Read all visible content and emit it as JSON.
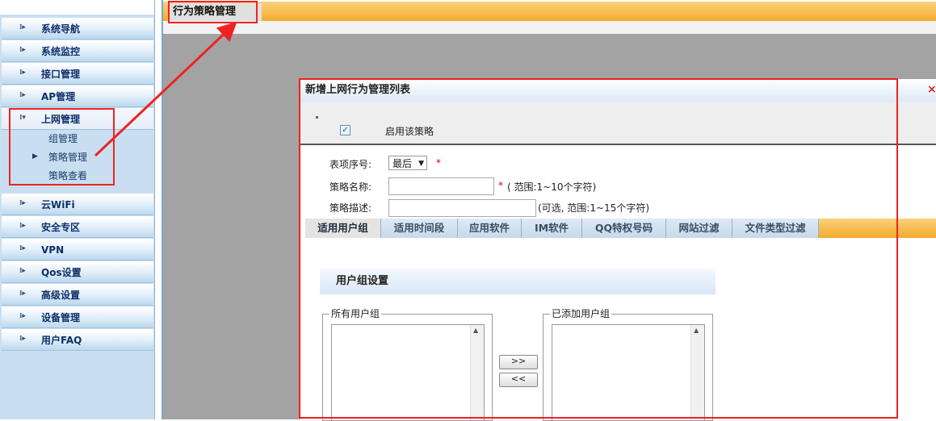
{
  "sidebar": {
    "items": [
      {
        "label": "系统导航"
      },
      {
        "label": "系统监控"
      },
      {
        "label": "接口管理"
      },
      {
        "label": "AP管理"
      },
      {
        "label": "上网管理"
      },
      {
        "label": "云WiFi"
      },
      {
        "label": "安全专区"
      },
      {
        "label": "VPN"
      },
      {
        "label": "Qos设置"
      },
      {
        "label": "高级设置"
      },
      {
        "label": "设备管理"
      },
      {
        "label": "用户FAQ"
      }
    ],
    "subitems": [
      {
        "label": "组管理"
      },
      {
        "label": "策略管理"
      },
      {
        "label": "策略查看"
      }
    ]
  },
  "header": {
    "title": "行为策略管理"
  },
  "dialog": {
    "title": "新增上网行为管理列表",
    "close": "×",
    "enable_label": "启用该策略",
    "enable_checked": true,
    "fields": {
      "seq_label": "表项序号:",
      "seq_value": "最后",
      "required_mark": "*",
      "name_label": "策略名称:",
      "name_hint": "( 范围:1~10个字符)",
      "desc_label": "策略描述:",
      "desc_hint": "(可选, 范围:1~15个字符)"
    },
    "tabs": [
      {
        "label": "适用用户组"
      },
      {
        "label": "适用时间段"
      },
      {
        "label": "应用软件"
      },
      {
        "label": "IM软件"
      },
      {
        "label": "QQ特权号码"
      },
      {
        "label": "网站过滤"
      },
      {
        "label": "文件类型过滤"
      }
    ],
    "group_settings": {
      "title": "用户组设置",
      "all_groups_label": "所有用户组",
      "added_groups_label": "已添加用户组",
      "add_btn": ">>",
      "remove_btn": "<<"
    }
  },
  "colors": {
    "annotation": "#ee2222",
    "header_orange": "#f3aa2d",
    "sidebar_blue": "#c9dff1"
  }
}
